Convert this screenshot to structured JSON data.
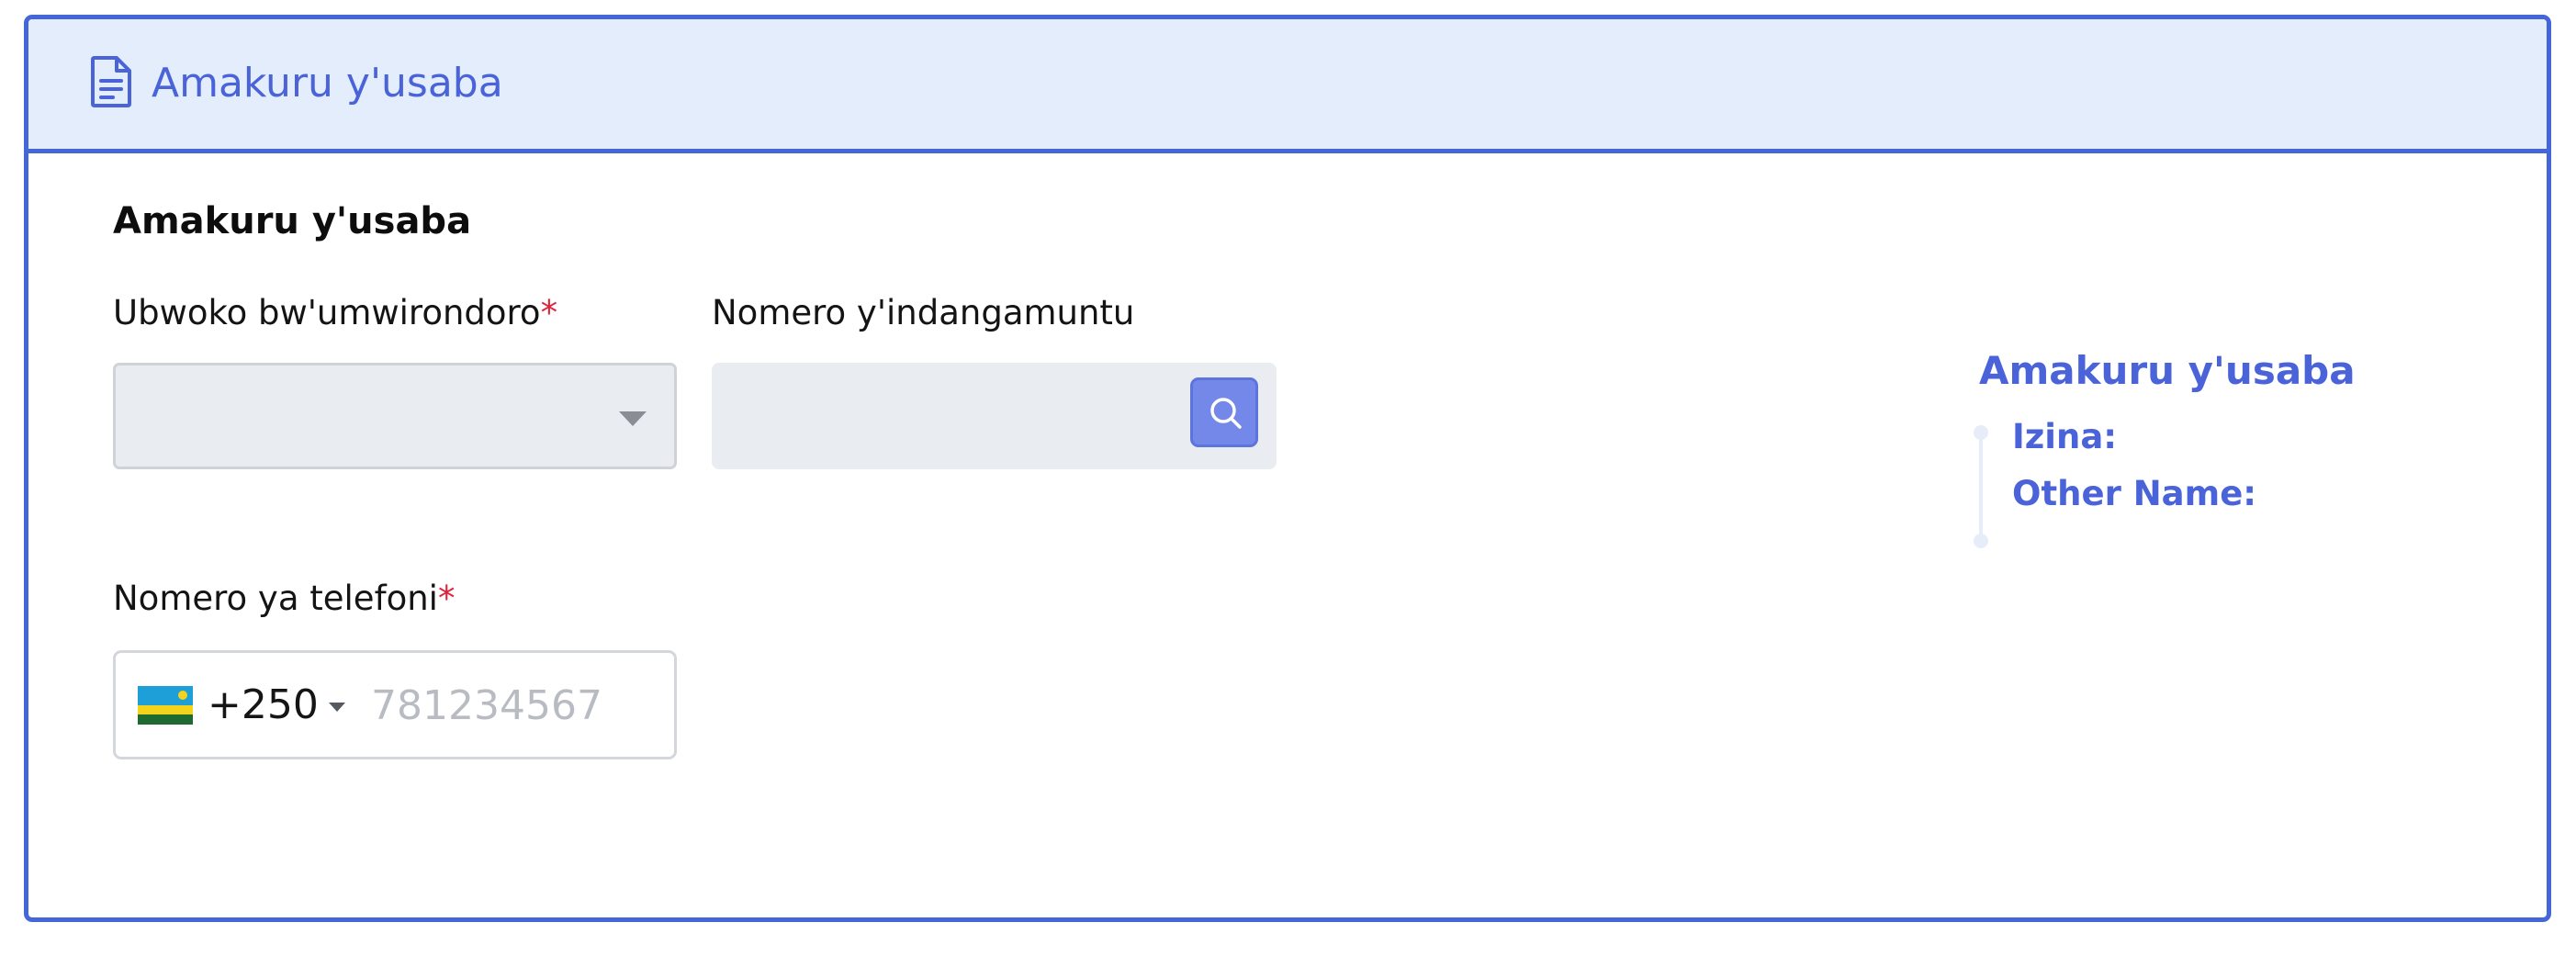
{
  "header": {
    "title": "Amakuru y'usaba",
    "icon": "document-icon"
  },
  "form": {
    "section_title": "Amakuru y'usaba",
    "id_type": {
      "label": "Ubwoko bw'umwirondoro",
      "required_mark": "*",
      "value": ""
    },
    "id_number": {
      "label": "Nomero y'indangamuntu",
      "value": "",
      "search_icon": "search-icon"
    },
    "phone": {
      "label": "Nomero ya telefoni",
      "required_mark": "*",
      "country_flag": "rwanda-flag-icon",
      "dial_code": "+250",
      "placeholder": "781234567",
      "value": ""
    }
  },
  "summary": {
    "title": "Amakuru y'usaba",
    "items": [
      {
        "label": "Izina:"
      },
      {
        "label": "Other Name:"
      }
    ]
  },
  "colors": {
    "accent": "#4a63d8",
    "border": "#4566d9",
    "header_bg": "#e3edfc",
    "required": "#e0233c",
    "search_button": "#7388e8"
  }
}
